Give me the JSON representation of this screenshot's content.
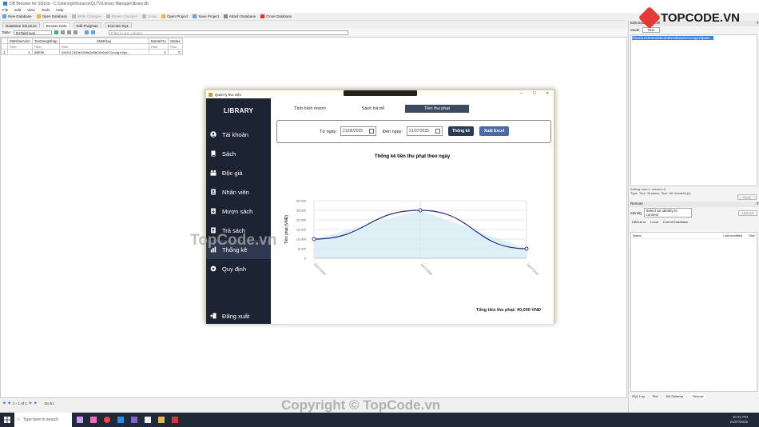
{
  "titlebar": {
    "title": "DB Browser for SQLite - C:\\Users\\gnit\\source\\QLTV\\Library Manager\\library.db"
  },
  "menubar": {
    "items": [
      "File",
      "Edit",
      "View",
      "Tools",
      "Help"
    ]
  },
  "toolbar": {
    "new_db": "New Database",
    "open_db": "Open Database",
    "write": "Write Changes",
    "revert": "Revert Changes",
    "undo": "Undo",
    "open_project": "Open Project",
    "save_project": "Save Project",
    "attach": "Attach Database",
    "close": "Close Database"
  },
  "dbtabs": [
    "Database Structure",
    "Browse Data",
    "Edit Pragmas",
    "Execute SQL"
  ],
  "tablebar": {
    "label": "Table:",
    "table": "DsTaiKhoan",
    "filter_placeholder": "Filter in any column"
  },
  "grid": {
    "headers": [
      "",
      "MaNhanVien",
      "TenDangNhap",
      "MatKhau",
      "MaVaiTro",
      "Status"
    ],
    "filter_placeholder": "Filter",
    "rows": [
      [
        "1",
        "1",
        "admin",
        "02a3112350e0288e2b8fe18b2a0C0co4g1r0pe...",
        "1",
        "0"
      ]
    ]
  },
  "statusbar": {
    "pager": "1 - 1 of 1",
    "goto": "Go to:"
  },
  "rightpanel": {
    "edit_title": "Edit Database Cell",
    "mode_label": "Mode:",
    "mode_value": "Text",
    "cell_value": "02a3112350e0288e2b8fe18b2a0C0co4g1r0pe6c...",
    "cell_info": "Editing row=1, column=3",
    "type_info": "Type: Text / Numeric; Size: 60 character(s)",
    "apply": "Apply",
    "remote_title": "Remote",
    "identity_label": "Identity",
    "identity_value": "Select an identity to connect",
    "upload": "Upload",
    "remote_tabs": [
      "DBHub.io",
      "Local",
      "Current Database"
    ],
    "col_name": "Name",
    "col_modified": "Last modified",
    "col_size": "Size",
    "bottom_tabs": [
      "SQL Log",
      "Plot",
      "DB Schema",
      "Remote"
    ]
  },
  "taskbar": {
    "search": "Type here to search",
    "time": "10:31 PM",
    "date": "21/07/2025"
  },
  "app": {
    "title": "Quản lý thư viện",
    "logo": "LIBRARY",
    "nav": [
      "Tài khoản",
      "Sách",
      "Độc giả",
      "Nhân viên",
      "Mượn sách",
      "Trả sách",
      "Thống kê",
      "Quy định"
    ],
    "logout": "Đăng xuất",
    "tabs": [
      "Tình hình mượn",
      "Sách trả trễ",
      "Tiền thu phạt"
    ],
    "from_label": "Từ ngày:",
    "from_date": "21/06/2025",
    "to_label": "Đến ngày:",
    "to_date": "21/07/2025",
    "stat_btn": "Thống kê",
    "export_btn": "Xuất Excel",
    "total": "Tổng tiền thu phạt: 40,000 VNĐ"
  },
  "colors": {
    "sidebar": "#1c2333",
    "stat_btn": "#2b3a55",
    "export_btn": "#4a6aa8",
    "line": "#2d2f8f",
    "area": "#d6ecf3"
  },
  "chart_data": {
    "type": "area",
    "title": "Thống kê tiền thu phạt theo ngày",
    "ylabel": "Tiền phạt (VNĐ)",
    "xlabel": "",
    "categories": [
      "03/07/2025",
      "16/07/2025",
      "19/07/2025"
    ],
    "values": [
      10000,
      25000,
      5000
    ],
    "yticks": [
      "0",
      "5,000",
      "10,000",
      "15,000",
      "20,000",
      "25,000",
      "30,000"
    ],
    "ylim": [
      0,
      30000
    ],
    "grid": true
  },
  "watermark": {
    "logo": "TOPCODE.VN",
    "text1": "TopCode.vn",
    "text2": "Copyright © TopCode.vn"
  }
}
